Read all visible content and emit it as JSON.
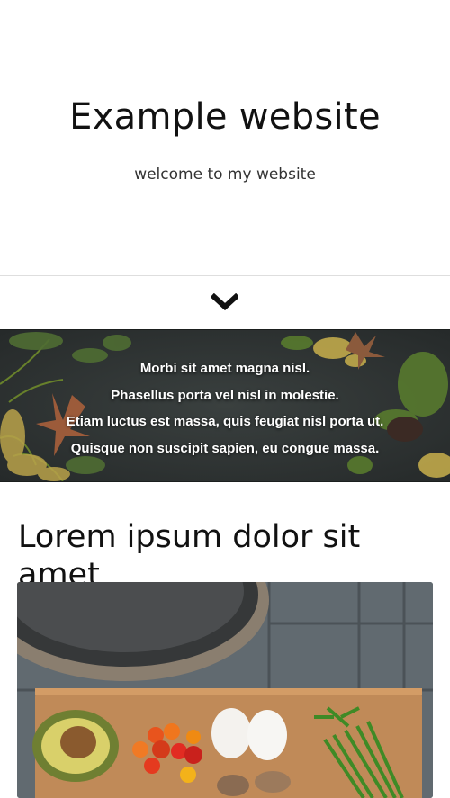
{
  "header": {
    "title": "Example website",
    "tagline": "welcome to my website"
  },
  "scroll": {
    "icon": "chevron-down-icon"
  },
  "banner": {
    "lines": [
      "Morbi sit amet magna nisl.",
      "Phasellus porta vel nisl in molestie.",
      "Etiam luctus est massa, quis feugiat nisl porta ut.",
      "Quisque non suscipit sapien, eu congue massa."
    ]
  },
  "main": {
    "heading": "Lorem ipsum dolor sit amet"
  },
  "colors": {
    "background": "#ffffff",
    "text": "#111111",
    "banner_bg": "#2f3433"
  }
}
